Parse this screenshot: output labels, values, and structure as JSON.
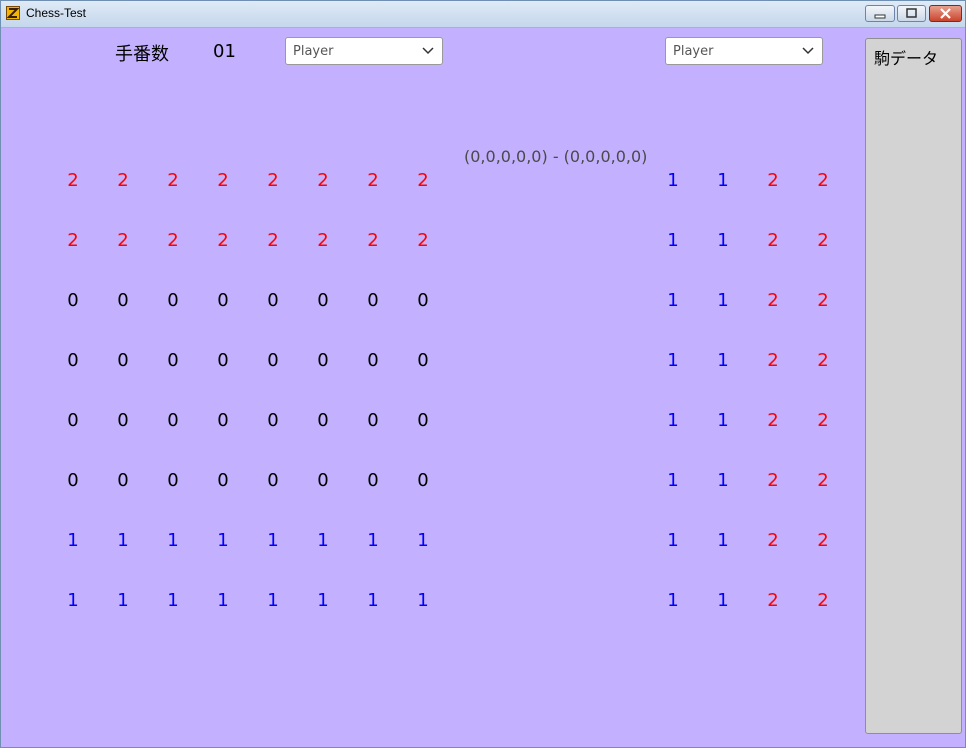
{
  "window": {
    "title": "Chess-Test"
  },
  "header": {
    "move_label": "手番数",
    "move_count": "01",
    "left_player": {
      "selected": "Player"
    },
    "right_player": {
      "selected": "Player"
    }
  },
  "coords_text": "(0,0,0,0,0) - (0,0,0,0,0)",
  "board": [
    [
      2,
      2,
      2,
      2,
      2,
      2,
      2,
      2
    ],
    [
      2,
      2,
      2,
      2,
      2,
      2,
      2,
      2
    ],
    [
      0,
      0,
      0,
      0,
      0,
      0,
      0,
      0
    ],
    [
      0,
      0,
      0,
      0,
      0,
      0,
      0,
      0
    ],
    [
      0,
      0,
      0,
      0,
      0,
      0,
      0,
      0
    ],
    [
      0,
      0,
      0,
      0,
      0,
      0,
      0,
      0
    ],
    [
      1,
      1,
      1,
      1,
      1,
      1,
      1,
      1
    ],
    [
      1,
      1,
      1,
      1,
      1,
      1,
      1,
      1
    ]
  ],
  "side_board": [
    [
      1,
      1,
      2,
      2
    ],
    [
      1,
      1,
      2,
      2
    ],
    [
      1,
      1,
      2,
      2
    ],
    [
      1,
      1,
      2,
      2
    ],
    [
      1,
      1,
      2,
      2
    ],
    [
      1,
      1,
      2,
      2
    ],
    [
      1,
      1,
      2,
      2
    ],
    [
      1,
      1,
      2,
      2
    ]
  ],
  "piece_panel": {
    "title": "駒データ"
  },
  "colors": {
    "zero": "#000000",
    "one": "#0000ff",
    "two": "#ff0000",
    "background": "#c3b1ff"
  },
  "icons": {
    "app": "app-icon",
    "minimize": "minimize-icon",
    "maximize": "maximize-icon",
    "close": "close-icon",
    "dropdown": "chevron-down-icon"
  }
}
